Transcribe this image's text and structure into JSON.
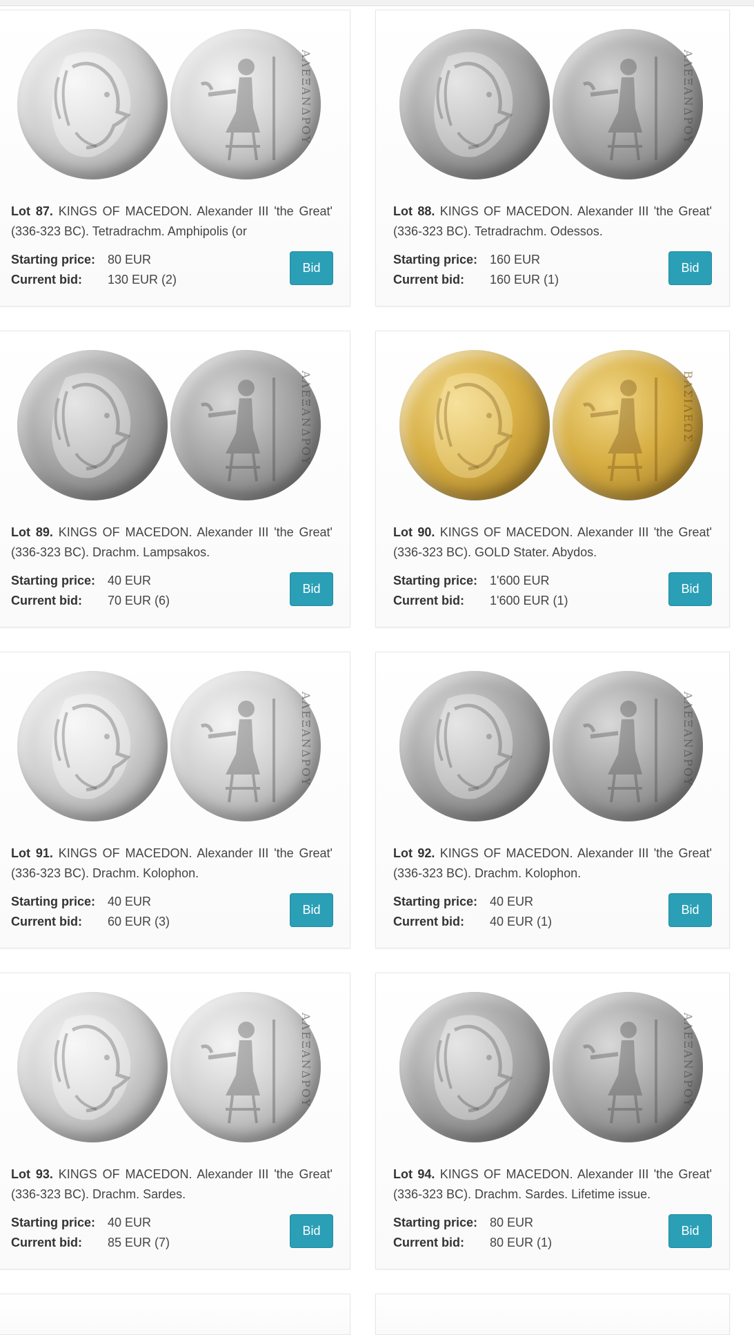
{
  "labels": {
    "starting_price": "Starting price:",
    "current_bid": "Current bid:",
    "bid_button": "Bid"
  },
  "colors": {
    "bid_button": "#2a9fb6",
    "card_border": "#e6e6e6"
  },
  "lots": [
    {
      "lot_label": "Lot 87.",
      "description": "KINGS OF MACEDON. Alexander III 'the Great' (336-323 BC). Tetradrachm. Amphipolis (or",
      "starting_price": "80 EUR",
      "current_bid": "130 EUR (2)",
      "coin_style": "silver",
      "legend": "ΑΛΕΞΑΝΔΡΟΥ"
    },
    {
      "lot_label": "Lot 88.",
      "description": "KINGS OF MACEDON. Alexander III 'the Great' (336-323 BC). Tetradrachm. Odessos.",
      "starting_price": "160 EUR",
      "current_bid": "160 EUR (1)",
      "coin_style": "silver-dark",
      "legend": "ΑΛΕΞΑΝΔΡΟΥ"
    },
    {
      "lot_label": "Lot 89.",
      "description": "KINGS OF MACEDON. Alexander III 'the Great' (336-323 BC). Drachm. Lampsakos.",
      "starting_price": "40 EUR",
      "current_bid": "70 EUR (6)",
      "coin_style": "silver-dark",
      "legend": "ΑΛΕΞΑΝΔΡΟΥ"
    },
    {
      "lot_label": "Lot 90.",
      "description": "KINGS OF MACEDON. Alexander III 'the Great' (336-323 BC). GOLD Stater. Abydos.",
      "starting_price": "1'600 EUR",
      "current_bid": "1'600 EUR (1)",
      "coin_style": "gold",
      "legend": "ΒΑΣΙΛΕΩΣ"
    },
    {
      "lot_label": "Lot 91.",
      "description": "KINGS OF MACEDON. Alexander III 'the Great' (336-323 BC). Drachm. Kolophon.",
      "starting_price": "40 EUR",
      "current_bid": "60 EUR (3)",
      "coin_style": "silver",
      "legend": "ΑΛΕΞΑΝΔΡΟΥ"
    },
    {
      "lot_label": "Lot 92.",
      "description": "KINGS OF MACEDON. Alexander III 'the Great' (336-323 BC). Drachm. Kolophon.",
      "starting_price": "40 EUR",
      "current_bid": "40 EUR (1)",
      "coin_style": "silver-dark",
      "legend": "ΑΛΕΞΑΝΔΡΟΥ"
    },
    {
      "lot_label": "Lot 93.",
      "description": "KINGS OF MACEDON. Alexander III 'the Great' (336-323 BC). Drachm. Sardes.",
      "starting_price": "40 EUR",
      "current_bid": "85 EUR (7)",
      "coin_style": "silver",
      "legend": "ΑΛΕΞΑΝΔΡΟΥ"
    },
    {
      "lot_label": "Lot 94.",
      "description": "KINGS OF MACEDON. Alexander III 'the Great' (336-323 BC). Drachm. Sardes. Lifetime issue.",
      "starting_price": "80 EUR",
      "current_bid": "80 EUR (1)",
      "coin_style": "silver-dark",
      "legend": "ΑΛΕΞΑΝΔΡΟΥ"
    }
  ]
}
